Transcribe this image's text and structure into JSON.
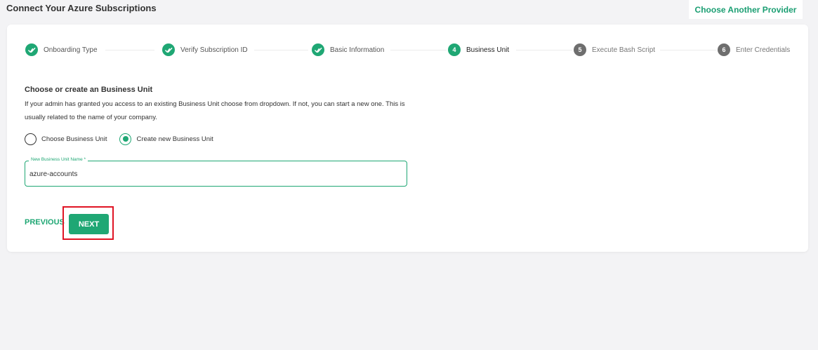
{
  "header": {
    "title": "Connect Your Azure Subscriptions",
    "provider_button": "Choose Another Provider"
  },
  "stepper": {
    "steps": [
      {
        "number": "✓",
        "label": "Onboarding Type",
        "state": "done"
      },
      {
        "number": "✓",
        "label": "Verify Subscription ID",
        "state": "done"
      },
      {
        "number": "✓",
        "label": "Basic Information",
        "state": "done"
      },
      {
        "number": "4",
        "label": "Business Unit",
        "state": "active"
      },
      {
        "number": "5",
        "label": "Execute Bash Script",
        "state": "pending"
      },
      {
        "number": "6",
        "label": "Enter Credentials",
        "state": "pending"
      }
    ]
  },
  "form": {
    "section_title": "Choose or create an Business Unit",
    "description": "If your admin has granted you access to an existing Business Unit choose from dropdown. If not, you can start a new one. This is usually related to the name of your company.",
    "radio_options": [
      {
        "label": "Choose Business Unit",
        "checked": false
      },
      {
        "label": "Create new Business Unit",
        "checked": true
      }
    ],
    "field_label": "New Business Unit Name *",
    "field_value": "azure-accounts"
  },
  "actions": {
    "previous_label": "PREVIOUS",
    "next_label": "NEXT"
  },
  "colors": {
    "accent": "#1fa774",
    "pending_step": "#6e6e6e",
    "highlight": "#e01424",
    "background": "#f3f3f5"
  }
}
